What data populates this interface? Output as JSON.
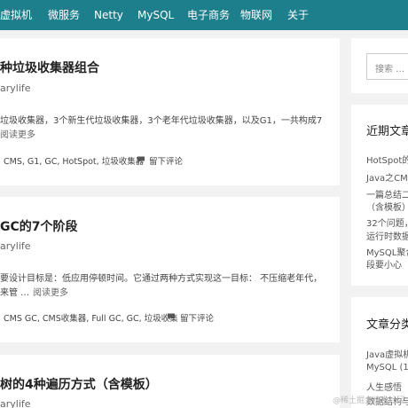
{
  "nav": {
    "items": [
      "虚拟机",
      "微服务",
      "Netty",
      "MySQL",
      "电子商务",
      "物联网",
      "关于"
    ]
  },
  "posts": [
    {
      "title": "种垃圾收集器组合",
      "author": "arylife",
      "excerpt": "垃圾收集器，3个新生代垃圾收集器，3个老年代垃圾收集器，以及G1，一共构成7",
      "excerpt2": "",
      "more": "阅读更多",
      "tags": "CMS, G1, GC, HotSpot, 垃圾收集器",
      "comment": "留下评论"
    },
    {
      "title": "GC的7个阶段",
      "author": "arylife",
      "excerpt": "要设计目标是：低应用停顿时间。它通过两种方式实现这一目标： 不压缩老年代，",
      "excerpt2": "来管 …",
      "more": "阅读更多",
      "tags": "CMS GC, CMS收集器, Full GC, GC, 垃圾收集",
      "comment": "留下评论"
    },
    {
      "title": "树的4种遍历方式（含模板）",
      "author": "arylife"
    }
  ],
  "sidebar": {
    "search_placeholder": "搜索 …",
    "recent_heading": "近期文章",
    "recent": [
      "HotSpot的",
      "Java之CMS",
      "一篇总结二",
      "（含模板）",
      "32个问题，",
      "运行时数据",
      "MySQL聚合",
      "段要小心"
    ],
    "categories_heading": "文章分类",
    "categories": [
      "Java虚拟机",
      "MySQL (1)",
      "人生感悟",
      "数据结构与"
    ]
  },
  "watermark": "@稀土掘金技术社区"
}
